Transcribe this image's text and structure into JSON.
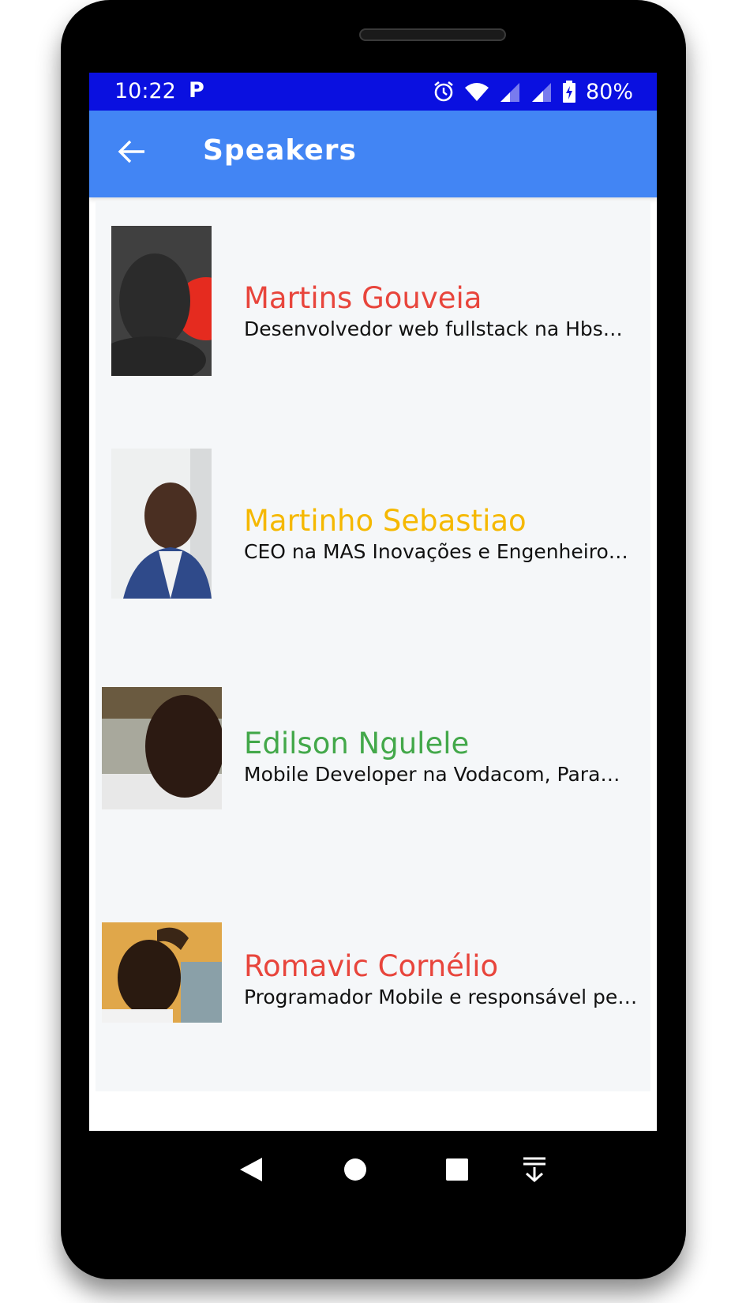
{
  "status_bar": {
    "time": "10:22",
    "p_glyph": "P",
    "battery": "80%",
    "icons": [
      "alarm-icon",
      "wifi-icon",
      "signal-icon",
      "signal-icon",
      "battery-icon"
    ]
  },
  "app_bar": {
    "title": "Speakers",
    "back_icon": "arrow-back-icon"
  },
  "speakers": [
    {
      "name": "Martins Gouveia",
      "description": "Desenvolvedor web fullstack na Hbsm…",
      "name_color": "#e8453c"
    },
    {
      "name": "Martinho Sebastiao",
      "description": "CEO na MAS Inovações e Engenheiro…",
      "name_color": "#f5b800"
    },
    {
      "name": "Edilson Ngulele",
      "description": "Mobile Developer na Vodacom,  Para…",
      "name_color": "#43a84a"
    },
    {
      "name": "Romavic Cornélio",
      "description": "Programador Mobile e responsável pe…",
      "name_color": "#e8453c"
    }
  ],
  "nav_bar": {
    "icons": [
      "back-triangle-icon",
      "home-circle-icon",
      "recents-square-icon",
      "notifications-pull-icon"
    ]
  },
  "colors": {
    "status_bar": "#0a10e0",
    "app_bar": "#4285f4",
    "card_bg": "#f5f7f9"
  }
}
